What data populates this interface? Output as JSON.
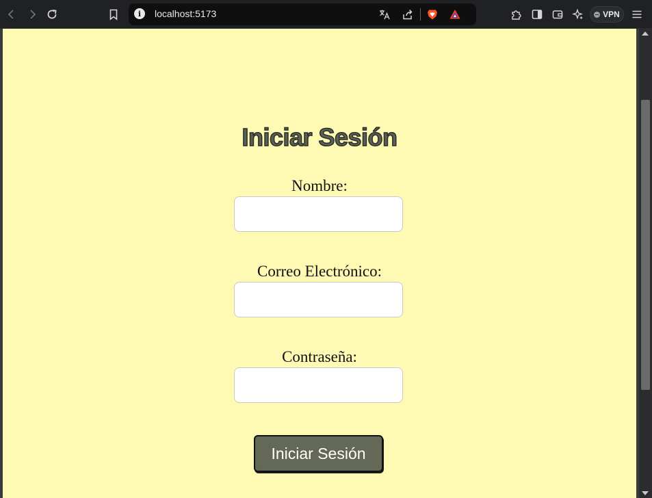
{
  "browser": {
    "url": "localhost:5173",
    "vpn_label": "VPN",
    "icons": {
      "back": "chevron-left-icon",
      "forward": "chevron-right-icon",
      "reload": "reload-icon",
      "bookmark": "bookmark-icon",
      "site_info": "info-icon",
      "translate": "translate-icon",
      "share": "share-icon",
      "brave_shields": "brave-shields-icon",
      "brave_rewards": "brave-rewards-icon",
      "extensions": "puzzle-icon",
      "sidebar": "sidebar-icon",
      "wallet": "wallet-icon",
      "leo": "sparkle-icon",
      "menu": "hamburger-menu-icon"
    }
  },
  "page": {
    "background": "#fffab3",
    "title": "Iniciar Sesión",
    "fields": [
      {
        "label": "Nombre:",
        "value": ""
      },
      {
        "label": "Correo Electrónico:",
        "value": ""
      },
      {
        "label": "Contraseña:",
        "value": ""
      }
    ],
    "submit_label": "Iniciar Sesión",
    "colors": {
      "title": "#5b6052",
      "button": "#646856"
    }
  }
}
